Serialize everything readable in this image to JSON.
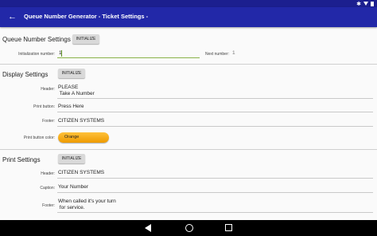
{
  "app": {
    "title": "Queue Number Generator  - Ticket Settings -"
  },
  "queue_settings": {
    "title": "Queue Number Settings",
    "initialize_label": "INITIALIZE",
    "init_number_label": "Initialization number:",
    "init_number_value": "1",
    "next_number_label": "Next number:",
    "next_number_value": "1"
  },
  "display_settings": {
    "title": "Display Settings",
    "initialize_label": "INITIALIZE",
    "header_label": "Header:",
    "header_value": "PLEASE\n Take A Number",
    "print_button_label": "Print button:",
    "print_button_value": "Press Here",
    "footer_label": "Footer:",
    "footer_value": "CITIZEN SYSTEMS",
    "print_button_color_label": "Print button color:",
    "print_button_color_value": "Orange",
    "print_button_color_hex": "#f5a800"
  },
  "print_settings": {
    "title": "Print Settings",
    "initialize_label": "INITIALIZE",
    "header_label": "Header:",
    "header_value": "CITIZEN SYSTEMS",
    "caption_label": "Caption:",
    "caption_value": "Your Number",
    "footer_label": "Footer:",
    "footer_value": "When called it's your turn\n for service."
  },
  "colors": {
    "appbar": "#2228a8",
    "statusbar": "#1c1f8f",
    "accent_underline": "#8ab34a"
  }
}
